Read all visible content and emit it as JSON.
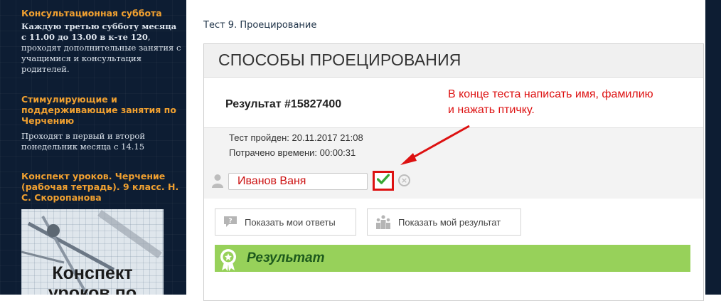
{
  "sidebar": {
    "blocks": [
      {
        "title": "Консультационная суббота",
        "text_bold": "Каждую третью субботу месяца с 11.00 до 13.00 в к-те 120",
        "text_rest": ", проходят дополнительные занятия с учащимися и консультация родителей."
      },
      {
        "title": "Стимулирующие и поддерживающие занятия по Черчению",
        "text": "Проходят в первый и второй понедельник месяца с 14.15"
      },
      {
        "title": "Конспект уроков. Черчение (рабочая тетрадь). 9 класс. Н. С. Скоропанова"
      }
    ],
    "book": {
      "line1": "Конспект",
      "line2": "уроков по"
    }
  },
  "content": {
    "breadcrumb": "Тест 9. Проецирование",
    "quiz_title": "СПОСОБЫ ПРОЕЦИРОВАНИЯ",
    "result_id": "Результат #15827400",
    "annotation_line1": "В конце теста написать имя, фамилию",
    "annotation_line2": "и нажать птичку.",
    "test_passed": "Тест пройден: 20.11.2017 21:08",
    "time_spent": "Потрачено времени: 00:00:31",
    "name_value": "Иванов Ваня",
    "cancel_symbol": "×",
    "buttons": {
      "show_answers": "Показать мои ответы",
      "show_result": "Показать мой результат"
    },
    "result_section": "Результат"
  },
  "colors": {
    "accent_orange": "#f0a030",
    "annotation_red": "#dd1111",
    "result_green": "#97d15a",
    "check_green": "#3aa835",
    "sidebar_bg": "#0d1d33"
  },
  "icons": [
    "user-icon",
    "check-icon",
    "close-circle-icon",
    "question-bubble-icon",
    "people-podium-icon",
    "award-badge-icon"
  ]
}
